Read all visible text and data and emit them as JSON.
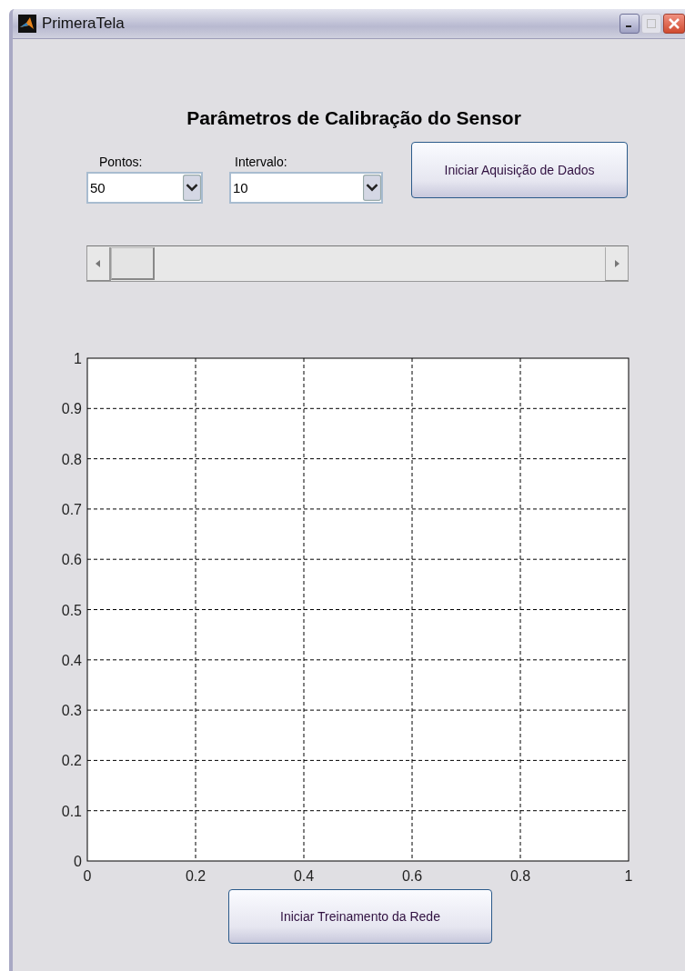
{
  "window": {
    "title": "PrimeraTela"
  },
  "heading": "Parâmetros de Calibração do Sensor",
  "selects": [
    {
      "label": "Pontos:",
      "value": "50"
    },
    {
      "label": "Intervalo:",
      "value": "10"
    }
  ],
  "acquire_button": "Iniciar Aquisição de Dados",
  "slider": {
    "level": 0
  },
  "plot": {
    "chart_data": {
      "type": "line",
      "grid": true,
      "xlim": [
        0,
        1
      ],
      "ylim": [
        0,
        1
      ],
      "xticks": [
        {
          "value": 0,
          "label": "0"
        },
        {
          "value": 0.2,
          "label": "0.2"
        },
        {
          "value": 0.4,
          "label": "0.4"
        },
        {
          "value": 0.6,
          "label": "0.6"
        },
        {
          "value": 0.8,
          "label": "0.8"
        },
        {
          "value": 1,
          "label": "1"
        }
      ],
      "yticks": [
        {
          "value": 0,
          "label": "0"
        },
        {
          "value": 0.1,
          "label": "0.1"
        },
        {
          "value": 0.2,
          "label": "0.2"
        },
        {
          "value": 0.3,
          "label": "0.3"
        },
        {
          "value": 0.4,
          "label": "0.4"
        },
        {
          "value": 0.5,
          "label": "0.5"
        },
        {
          "value": 0.6,
          "label": "0.6"
        },
        {
          "value": 0.7,
          "label": "0.7"
        },
        {
          "value": 0.8,
          "label": "0.8"
        },
        {
          "value": 0.9,
          "label": "0.9"
        },
        {
          "value": 1,
          "label": "1"
        }
      ]
    }
  },
  "train_button": "Iniciar Treinamento da Rede"
}
